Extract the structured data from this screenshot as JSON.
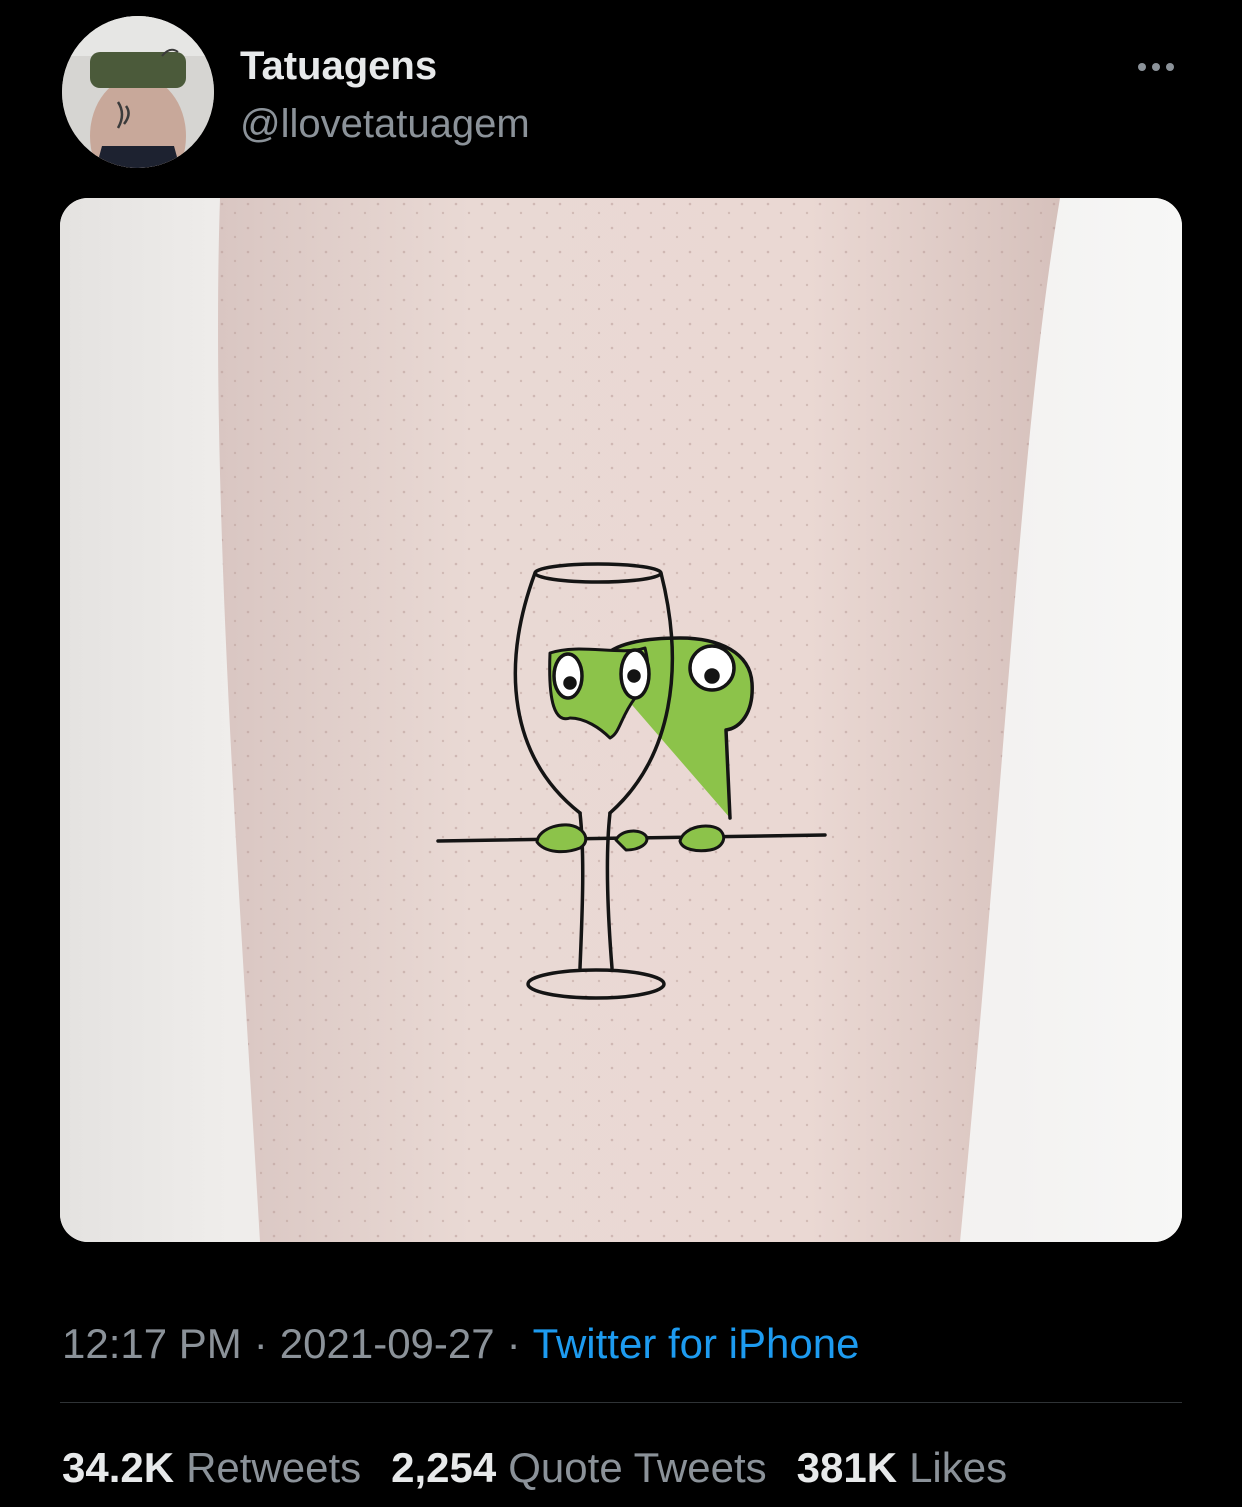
{
  "author": {
    "display_name": "Tatuagens",
    "handle": "@llovetatuagem",
    "avatar_icon": "profile-photo"
  },
  "more_icon": "ellipsis-icon",
  "media": {
    "description_icon": "tattoo-photo"
  },
  "meta": {
    "time": "12:17 PM",
    "date": "2021-09-27",
    "source": "Twitter for iPhone",
    "separator": "·"
  },
  "stats": {
    "retweets": {
      "count": "34.2K",
      "label": "Retweets"
    },
    "quotes": {
      "count": "2,254",
      "label": "Quote Tweets"
    },
    "likes": {
      "count": "381K",
      "label": "Likes"
    }
  },
  "colors": {
    "background": "#000000",
    "text_primary": "#e7e9ea",
    "text_secondary": "#8b9299",
    "link": "#1d9bf0",
    "divider": "#2f3336",
    "frog_green": "#7bb63f"
  }
}
